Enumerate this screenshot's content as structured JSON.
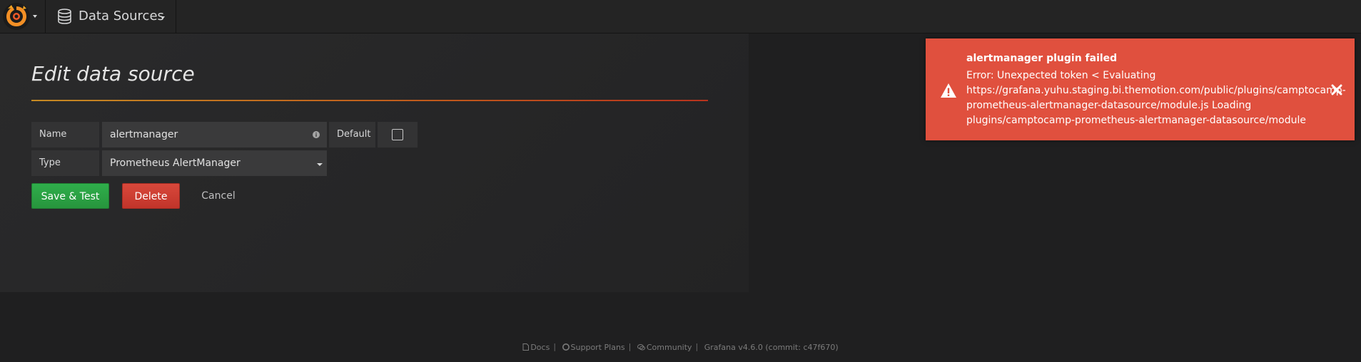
{
  "navbar": {
    "section_label": "Data Sources"
  },
  "page": {
    "title": "Edit data source"
  },
  "form": {
    "name_label": "Name",
    "name_value": "alertmanager",
    "default_label": "Default",
    "default_checked": false,
    "type_label": "Type",
    "type_value": "Prometheus AlertManager"
  },
  "buttons": {
    "save": "Save & Test",
    "delete": "Delete",
    "cancel": "Cancel"
  },
  "alert": {
    "title": "alertmanager plugin failed",
    "lines": [
      "Error: Unexpected token < Evaluating",
      "https://grafana.yuhu.staging.bi.themotion.com/public/plugins/camptocamp-",
      "prometheus-alertmanager-datasource/module.js Loading",
      "plugins/camptocamp-prometheus-alertmanager-datasource/module"
    ],
    "color": "#e0503e"
  },
  "footer": {
    "docs": "Docs",
    "support": "Support Plans",
    "community": "Community",
    "version": "Grafana v4.6.0 (commit: c47f670)"
  },
  "colors": {
    "success": "#27953d",
    "danger": "#c1342a",
    "accent_rule": "#c68a23"
  }
}
